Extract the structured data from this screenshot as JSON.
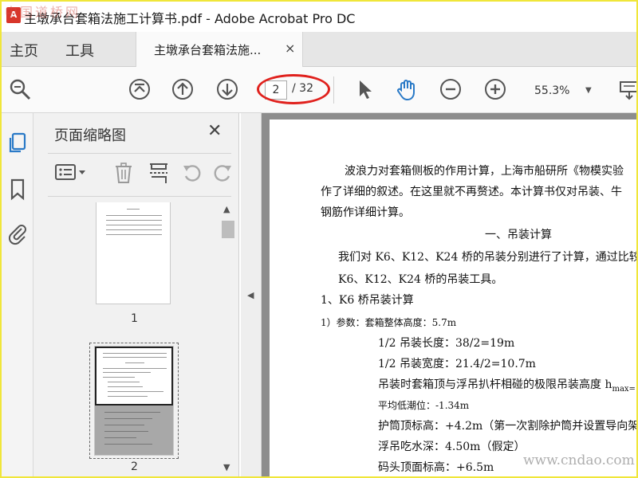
{
  "window": {
    "title": "主墩承台套箱法施工计算书.pdf - Adobe Acrobat Pro DC",
    "logo_text": "A"
  },
  "watermarks": {
    "top": "中国道桥网",
    "bottom": "www.cndao.com"
  },
  "nav_tabs": {
    "home": "主页",
    "tools": "工具"
  },
  "doc_tab": {
    "label": "主墩承台套箱法施...",
    "close": "×"
  },
  "toolbar": {
    "icons": [
      "zoom-search-icon",
      "first-page-icon",
      "prev-page-icon",
      "next-page-icon",
      "select-arrow-icon",
      "hand-tool-icon",
      "zoom-out-icon",
      "zoom-in-icon",
      "keyboard-icon"
    ],
    "current_page": "2",
    "page_total": "/ 32",
    "zoom": "55.3%",
    "highlight_color": "#e0211d",
    "accent_color": "#2a7ac7"
  },
  "rail": {
    "icons": [
      "copy-pages-icon",
      "bookmark-icon",
      "attachment-icon"
    ]
  },
  "thumbnail_panel": {
    "title": "页面缩略图",
    "close": "✕",
    "tools": [
      "thumbnail-options-icon",
      "delete-icon",
      "insert-icon",
      "rotate-left-icon",
      "rotate-right-icon"
    ],
    "pages": [
      {
        "label": "1"
      },
      {
        "label": "2"
      }
    ]
  },
  "document": {
    "lines": [
      "波浪力对套箱侧板的作用计算，上海市船研所《物模实验",
      "作了详细的叙述。在这里就不再赘述。本计算书仅对吊装、牛",
      "钢筋作详细计算。",
      "一、吊装计算",
      "我们对 K6、K12、K24 桥的吊装分别进行了计算，通过比较",
      "K6、K12、K24 桥的吊装工具。",
      "1、K6 桥吊装计算",
      "1）参数：套箱整体高度：5.7m",
      "1/2 吊装长度：38/2=19m",
      "1/2 吊装宽度：21.4/2=10.7m",
      "吊装时套箱顶与浮吊扒杆相碰的极限吊装高度 h",
      "max=",
      "平均低潮位：-1.34m",
      "护筒顶标高：+4.2m（第一次割除护筒并设置导向架",
      "浮吊吃水深：4.50m（假定）",
      "码头顶面标高：+6.5m"
    ]
  }
}
